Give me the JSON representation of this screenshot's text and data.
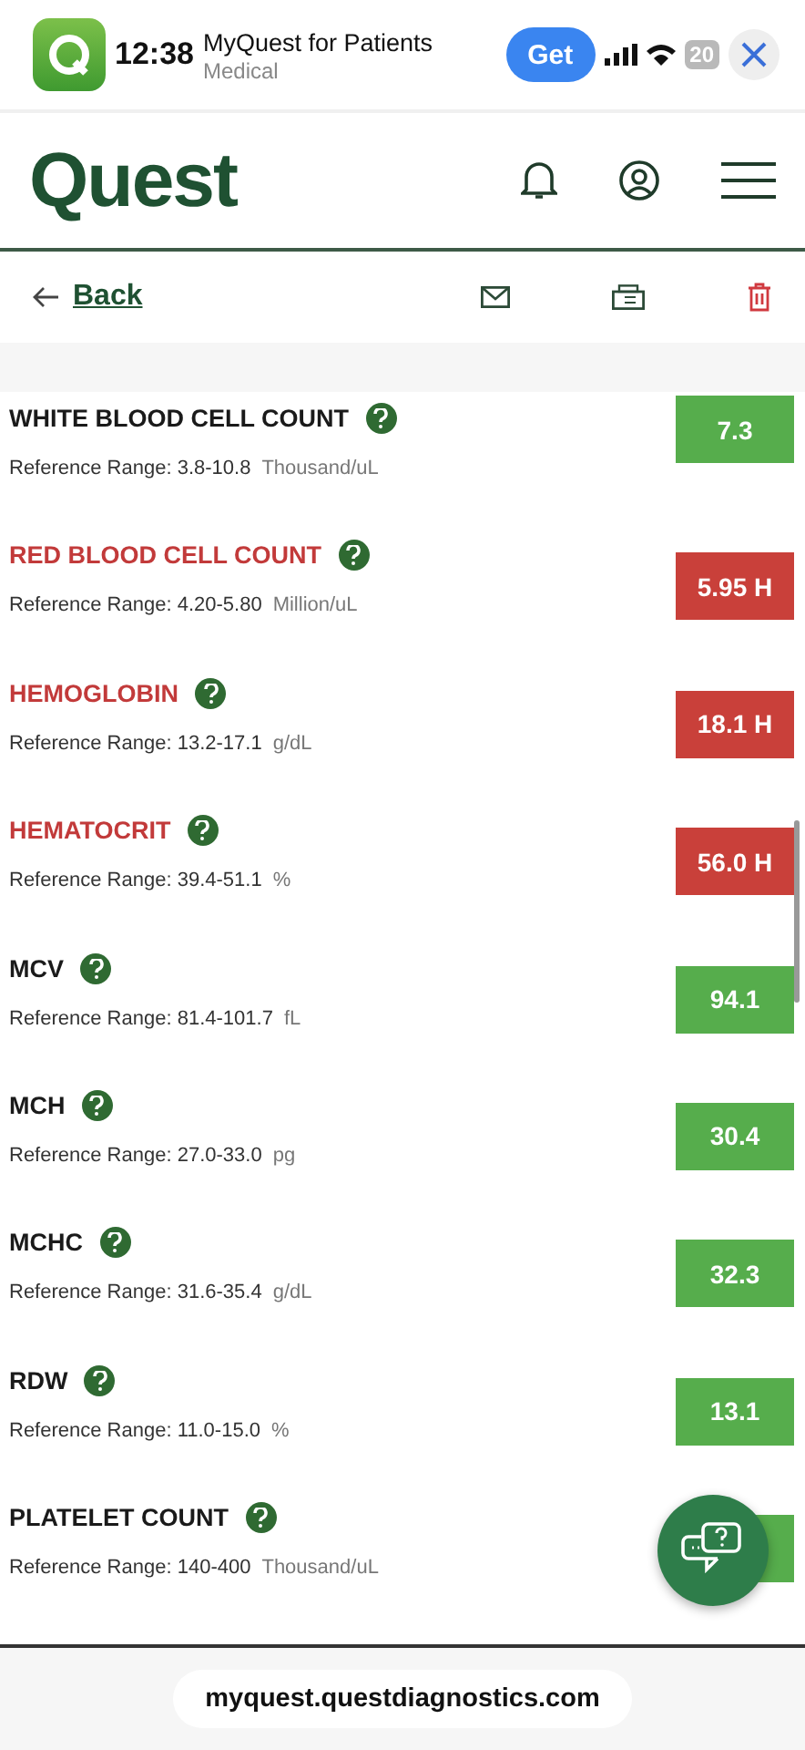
{
  "app_banner": {
    "app_name": "MyQuest for Patients",
    "category": "Medical",
    "get_label": "Get",
    "time": "12:38",
    "battery": "20"
  },
  "header": {
    "logo": "Quest"
  },
  "toolbar": {
    "back_label": "Back"
  },
  "results": [
    {
      "name": "WHITE BLOOD CELL COUNT",
      "range": "Reference Range: 3.8-10.8",
      "unit": "Thousand/uL",
      "value": "7.3",
      "high": false
    },
    {
      "name": "RED BLOOD CELL COUNT",
      "range": "Reference Range: 4.20-5.80",
      "unit": "Million/uL",
      "value": "5.95 H",
      "high": true
    },
    {
      "name": "HEMOGLOBIN",
      "range": "Reference Range: 13.2-17.1",
      "unit": "g/dL",
      "value": "18.1 H",
      "high": true
    },
    {
      "name": "HEMATOCRIT",
      "range": "Reference Range: 39.4-51.1",
      "unit": "%",
      "value": "56.0 H",
      "high": true
    },
    {
      "name": "MCV",
      "range": "Reference Range: 81.4-101.7",
      "unit": "fL",
      "value": "94.1",
      "high": false
    },
    {
      "name": "MCH",
      "range": "Reference Range: 27.0-33.0",
      "unit": "pg",
      "value": "30.4",
      "high": false
    },
    {
      "name": "MCHC",
      "range": "Reference Range: 31.6-35.4",
      "unit": "g/dL",
      "value": "32.3",
      "high": false
    },
    {
      "name": "RDW",
      "range": "Reference Range: 11.0-15.0",
      "unit": "%",
      "value": "13.1",
      "high": false
    },
    {
      "name": "PLATELET COUNT",
      "range": "Reference Range: 140-400",
      "unit": "Thousand/uL",
      "high": false
    }
  ],
  "browser": {
    "url": "myquest.questdiagnostics.com"
  }
}
